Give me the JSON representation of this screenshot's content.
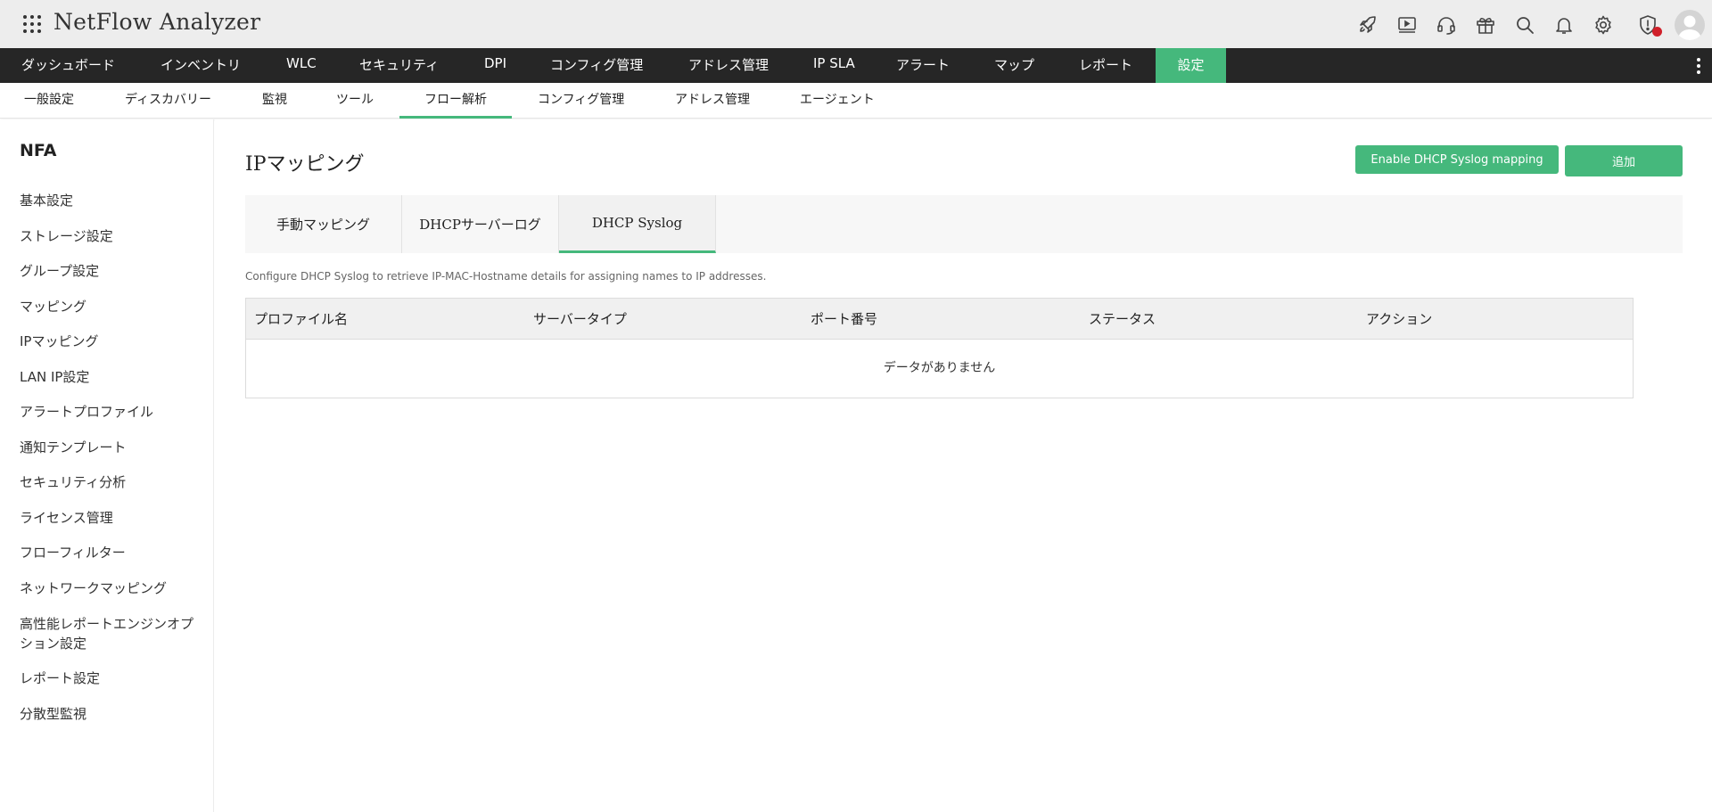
{
  "header": {
    "app_title": "NetFlow Analyzer",
    "icons": [
      "apps-grid-icon",
      "rocket-icon",
      "video-icon",
      "headset-icon",
      "gift-icon",
      "search-icon",
      "bell-icon",
      "gear-icon",
      "shield-alert-icon",
      "user-avatar-icon"
    ]
  },
  "main_nav": {
    "items": [
      {
        "label": "ダッシュボード"
      },
      {
        "label": "インベントリ"
      },
      {
        "label": "WLC"
      },
      {
        "label": "セキュリティ"
      },
      {
        "label": "DPI"
      },
      {
        "label": "コンフィグ管理"
      },
      {
        "label": "アドレス管理"
      },
      {
        "label": "IP SLA"
      },
      {
        "label": "アラート"
      },
      {
        "label": "マップ"
      },
      {
        "label": "レポート"
      },
      {
        "label": "設定",
        "active": true
      }
    ]
  },
  "sub_nav": {
    "items": [
      {
        "label": "一般設定"
      },
      {
        "label": "ディスカバリー"
      },
      {
        "label": "監視"
      },
      {
        "label": "ツール"
      },
      {
        "label": "フロー解析",
        "active": true
      },
      {
        "label": "コンフィグ管理"
      },
      {
        "label": "アドレス管理"
      },
      {
        "label": "エージェント"
      }
    ]
  },
  "sidebar": {
    "title": "NFA",
    "items": [
      {
        "label": "基本設定"
      },
      {
        "label": "ストレージ設定"
      },
      {
        "label": "グループ設定"
      },
      {
        "label": "マッピング"
      },
      {
        "label": "IPマッピング"
      },
      {
        "label": "LAN IP設定"
      },
      {
        "label": "アラートプロファイル"
      },
      {
        "label": "通知テンプレート"
      },
      {
        "label": "セキュリティ分析"
      },
      {
        "label": "ライセンス管理"
      },
      {
        "label": "フローフィルター"
      },
      {
        "label": "ネットワークマッピング"
      },
      {
        "label": "高性能レポートエンジンオプション設定"
      },
      {
        "label": "レポート設定"
      },
      {
        "label": "分散型監視"
      }
    ]
  },
  "main": {
    "page_title": "IPマッピング",
    "enable_button": "Enable DHCP Syslog mapping",
    "add_button": "追加",
    "tabs": [
      {
        "label": "手動マッピング"
      },
      {
        "label": "DHCPサーバーログ"
      },
      {
        "label": "DHCP Syslog",
        "active": true
      }
    ],
    "description": "Configure DHCP Syslog to retrieve IP-MAC-Hostname details for assigning names to IP addresses.",
    "table": {
      "columns": [
        "プロファイル名",
        "サーバータイプ",
        "ポート番号",
        "ステータス",
        "アクション"
      ],
      "empty_text": "データがありません"
    }
  },
  "colors": {
    "accent": "#45b87c",
    "nav_bg": "#262626",
    "header_bg": "#ededed",
    "alert_dot": "#d0202a"
  }
}
